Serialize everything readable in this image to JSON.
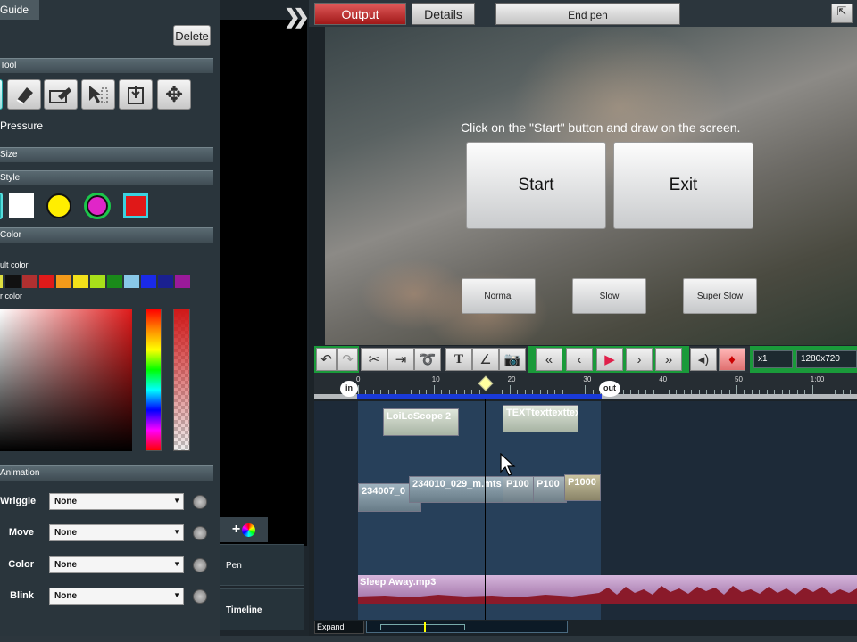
{
  "left_panel": {
    "guide_tab": "Guide",
    "delete_label": "Delete",
    "tool_section": "Tool",
    "pressure_label": "Pressure",
    "size_section": "Size",
    "style_section": "Style",
    "color_section": "Color",
    "default_color_label": "ult color",
    "user_color_label": "r color",
    "palette": [
      "#dede40",
      "#111111",
      "#b03030",
      "#e01a1a",
      "#f39a1a",
      "#f2e11a",
      "#a8e01a",
      "#1a8a1a",
      "#88c8e8",
      "#1a2ae8",
      "#1a2090",
      "#9a1a9a"
    ],
    "animation_section": "Animation",
    "animations": [
      {
        "label": "Wriggle",
        "value": "None"
      },
      {
        "label": "Move",
        "value": "None"
      },
      {
        "label": "Color",
        "value": "None"
      },
      {
        "label": "Blink",
        "value": "None"
      }
    ]
  },
  "side_tabs": {
    "pen": "Pen",
    "timeline": "Timeline",
    "add_icon": "plus-color-icon"
  },
  "top_bar": {
    "output_label": "Output",
    "details_label": "Details",
    "end_pen_label": "End pen"
  },
  "preview": {
    "instruction": "Click on the \"Start\" button and draw on the screen.",
    "start_label": "Start",
    "exit_label": "Exit",
    "normal_label": "Normal",
    "slow_label": "Slow",
    "super_slow_label": "Super Slow"
  },
  "toolbar": {
    "speed_value": "x1",
    "resolution_value": "1280x720"
  },
  "ruler": {
    "in_label": "in",
    "out_label": "out",
    "ticks": [
      "0",
      "10",
      "20",
      "30",
      "40",
      "50",
      "1:00"
    ]
  },
  "tracks": {
    "text_clip_1": "LoiLoScope 2",
    "text_clip_2": "TEXTtexttexttext",
    "video_clip_1": "234007_0",
    "video_clip_2": "234010_029_m.mts",
    "video_clip_3": "P100",
    "video_clip_4": "P100",
    "video_clip_5": "P1000",
    "audio_clip": "Sleep Away.mp3"
  },
  "footer": {
    "expand_label": "Expand"
  }
}
